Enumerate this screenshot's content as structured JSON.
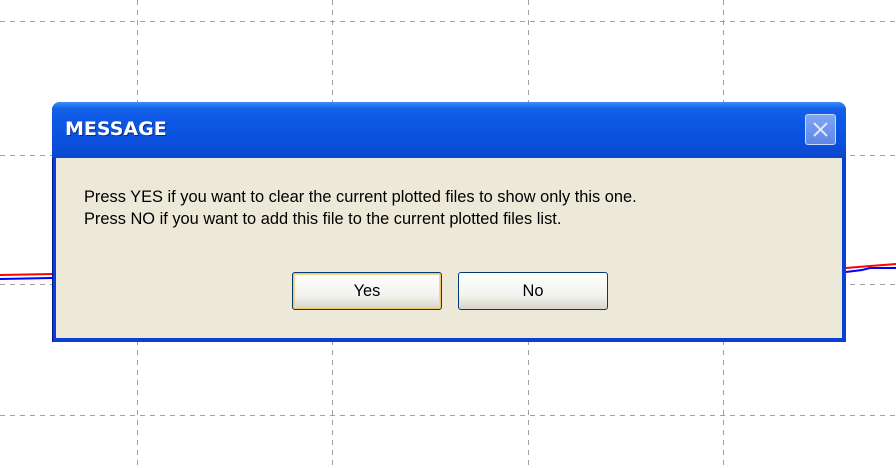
{
  "dialog": {
    "title": "MESSAGE",
    "message_line1": "Press YES if you want to clear the current plotted files to show only this one.",
    "message_line2": "Press NO if you want to add this file to the current plotted files list.",
    "yes_label": "Yes",
    "no_label": "No",
    "default_button": "Yes"
  },
  "icons": {
    "close": "close-icon"
  },
  "colors": {
    "titlebar": "#0a50dc",
    "client_bg": "#ece9d8",
    "grid": "#a0a0a0",
    "trace_red": "#ff0000",
    "trace_blue": "#0000ff"
  }
}
